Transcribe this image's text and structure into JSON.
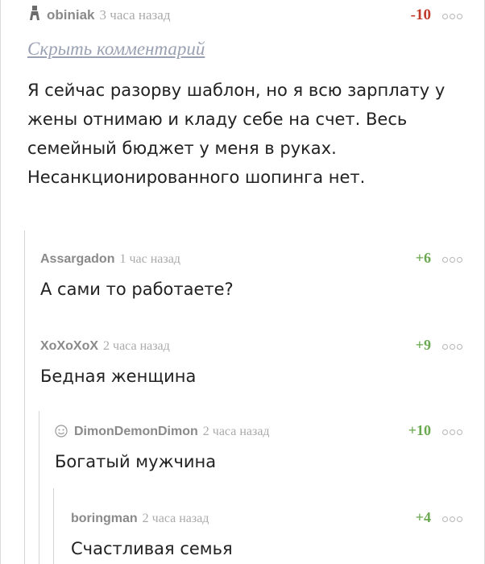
{
  "root": {
    "author": "obiniak",
    "time": "3 часа назад",
    "rating": "-10",
    "hide_link": "Скрыть комментарий",
    "text": "Я сейчас разорву шаблон, но я всю зарплату у жены отнимаю и кладу себе на счет.  Весь семейный бюджет у меня в руках. Несанкционированного шопинга нет.",
    "avatar_icon": "person-glyph-icon"
  },
  "replies": [
    {
      "author": "Assargadon",
      "time": "1 час назад",
      "rating": "+6",
      "text": "А сами то работаете?"
    },
    {
      "author": "XoXoXoX",
      "time": "2 часа назад",
      "rating": "+9",
      "text": "Бедная женщина"
    },
    {
      "author": "DimonDemonDimon",
      "time": "2 часа назад",
      "rating": "+10",
      "text": "Богатый мужчина",
      "avatar_icon": "smiley-icon"
    },
    {
      "author": "boringman",
      "time": "2 часа назад",
      "rating": "+4",
      "text": "Счастливая семья"
    }
  ],
  "colors": {
    "negative": "#c0392b",
    "positive": "#6aa84f",
    "link": "#9aa1b2"
  }
}
